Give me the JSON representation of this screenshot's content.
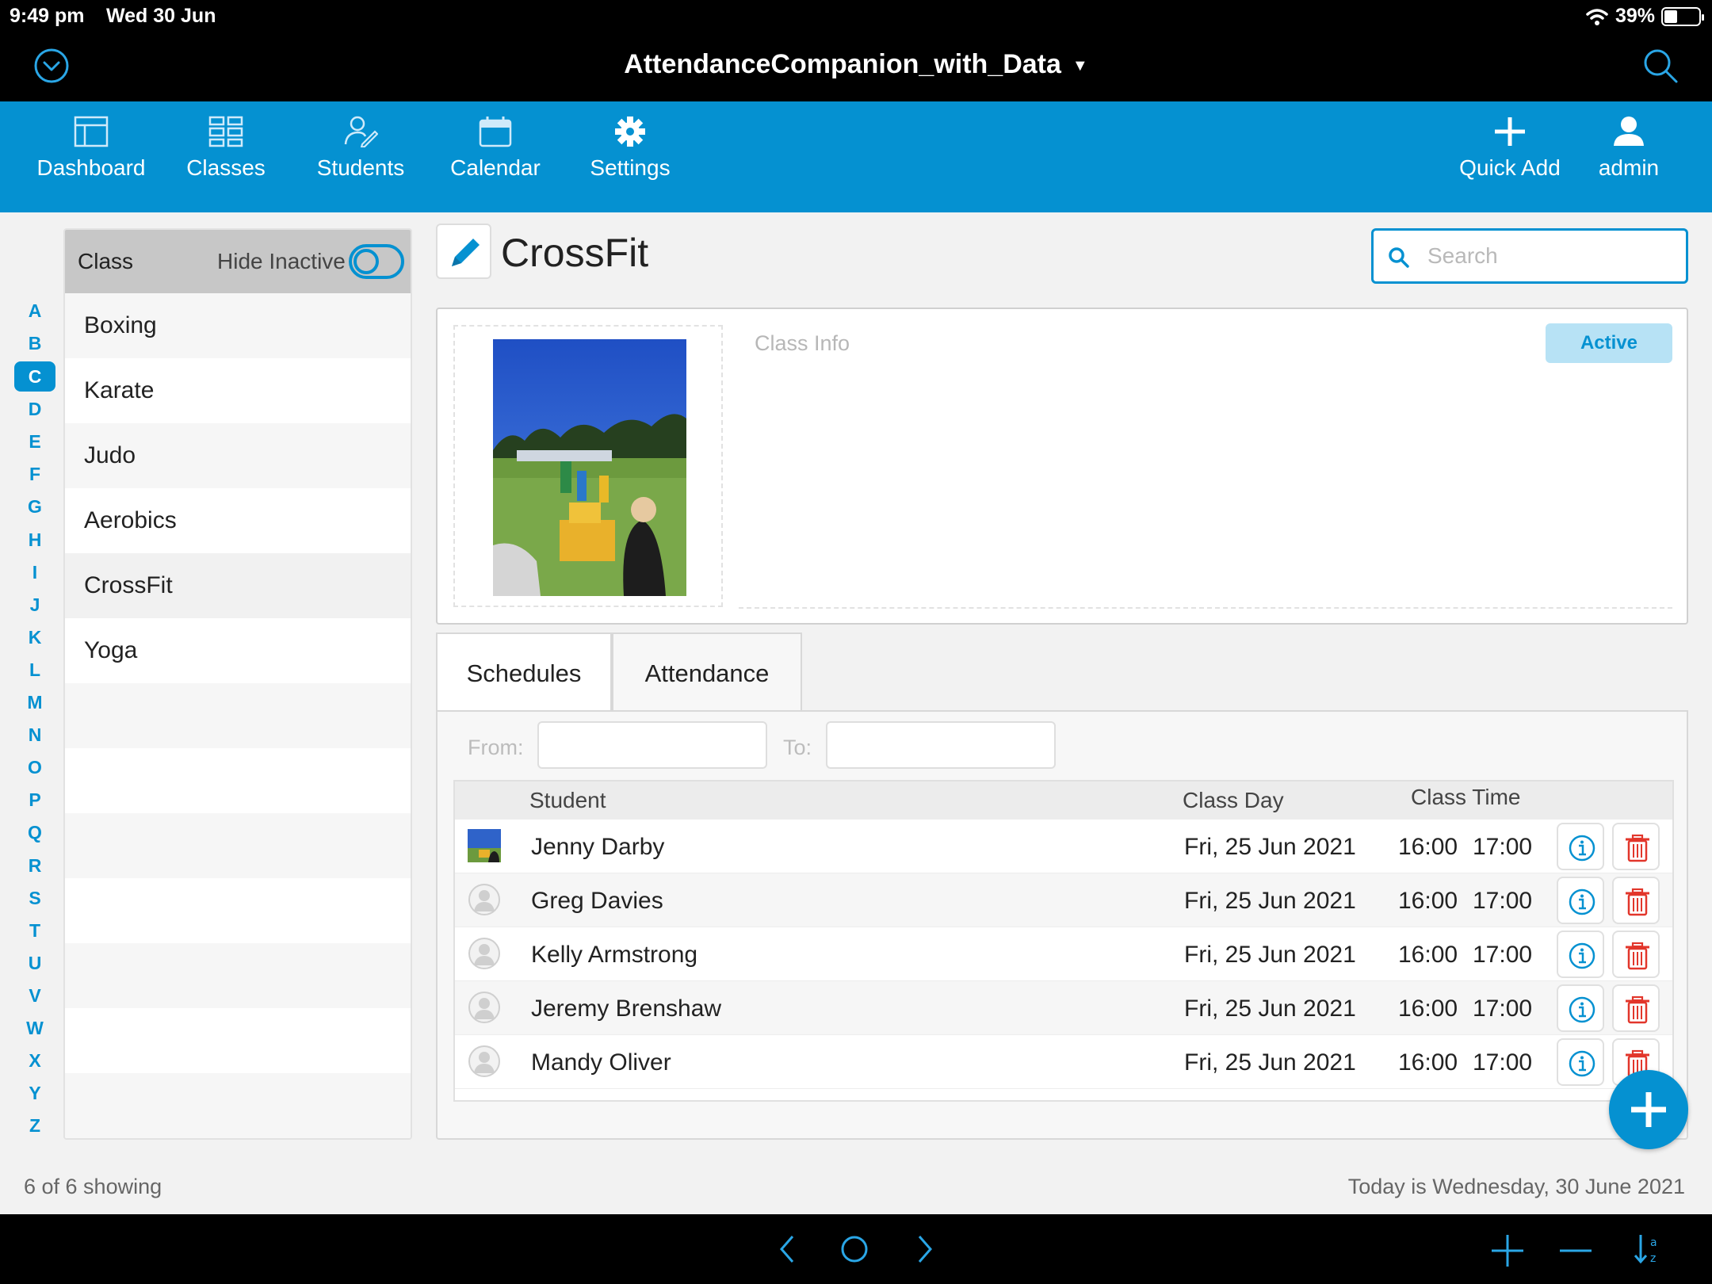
{
  "status_bar": {
    "time": "9:49 pm",
    "date": "Wed 30 Jun",
    "battery": "39%"
  },
  "title_bar": {
    "title": "AttendanceCompanion_with_Data"
  },
  "nav": {
    "items": [
      {
        "label": "Dashboard",
        "icon": "dashboard-icon"
      },
      {
        "label": "Classes",
        "icon": "grid-icon"
      },
      {
        "label": "Students",
        "icon": "student-icon"
      },
      {
        "label": "Calendar",
        "icon": "calendar-icon"
      },
      {
        "label": "Settings",
        "icon": "gear-icon"
      }
    ],
    "quick_add": "Quick Add",
    "user": "admin"
  },
  "alphabet": [
    "A",
    "B",
    "C",
    "D",
    "E",
    "F",
    "G",
    "H",
    "I",
    "J",
    "K",
    "L",
    "M",
    "N",
    "O",
    "P",
    "Q",
    "R",
    "S",
    "T",
    "U",
    "V",
    "W",
    "X",
    "Y",
    "Z"
  ],
  "alphabet_selected": "C",
  "class_list": {
    "header": "Class",
    "hide_inactive": "Hide Inactive",
    "items": [
      "Boxing",
      "Karate",
      "Judo",
      "Aerobics",
      "CrossFit",
      "Yoga"
    ],
    "selected": "CrossFit"
  },
  "detail": {
    "title": "CrossFit",
    "search_placeholder": "Search",
    "class_info_placeholder": "Class Info",
    "status": "Active"
  },
  "tabs": [
    {
      "label": "Schedules"
    },
    {
      "label": "Attendance"
    }
  ],
  "filters": {
    "from_label": "From:",
    "to_label": "To:"
  },
  "attendance": {
    "columns": {
      "student": "Student",
      "class_day": "Class Day",
      "class_time": "Class Time"
    },
    "rows": [
      {
        "student": "Jenny Darby",
        "day": "Fri, 25 Jun 2021",
        "start": "16:00",
        "end": "17:00",
        "photo": true
      },
      {
        "student": "Greg Davies",
        "day": "Fri, 25 Jun 2021",
        "start": "16:00",
        "end": "17:00",
        "photo": false
      },
      {
        "student": "Kelly Armstrong",
        "day": "Fri, 25 Jun 2021",
        "start": "16:00",
        "end": "17:00",
        "photo": false
      },
      {
        "student": "Jeremy Brenshaw",
        "day": "Fri, 25 Jun 2021",
        "start": "16:00",
        "end": "17:00",
        "photo": false
      },
      {
        "student": "Mandy Oliver",
        "day": "Fri, 25 Jun 2021",
        "start": "16:00",
        "end": "17:00",
        "photo": false
      }
    ]
  },
  "footer": {
    "count": "6 of 6 showing",
    "today": "Today is Wednesday, 30 June 2021"
  },
  "colors": {
    "accent": "#0591d1",
    "active_badge_bg": "#b7e2f5",
    "delete": "#e2362b"
  }
}
